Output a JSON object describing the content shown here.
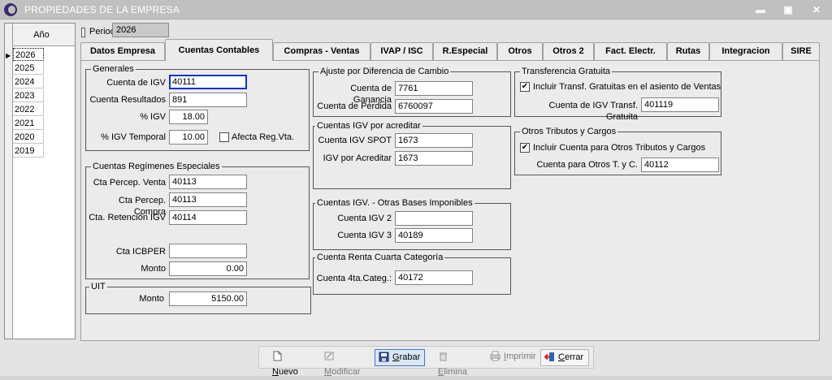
{
  "window": {
    "title": "PROPIEDADES DE LA EMPRESA",
    "minimize_glyph": "▬",
    "maximize_glyph": "▣",
    "close_glyph": "✕"
  },
  "years": {
    "header": "Año",
    "marker": "▶",
    "items": [
      "2026",
      "2025",
      "2024",
      "2023",
      "2022",
      "2021",
      "2020",
      "2019"
    ]
  },
  "periodo": {
    "label": "Periodo",
    "value": "2026"
  },
  "tabs": [
    "Datos Empresa",
    "Cuentas Contables",
    "Compras - Ventas",
    "IVAP / ISC",
    "R.Especial",
    "Otros",
    "Otros 2",
    "Fact. Electr.",
    "Rutas",
    "Integracion",
    "SIRE"
  ],
  "generales": {
    "title": "Generales",
    "cuenta_igv": {
      "label": "Cuenta de IGV",
      "value": "40111"
    },
    "cuenta_resultados": {
      "label": "Cuenta Resultados",
      "value": "891"
    },
    "pct_igv": {
      "label": "% IGV",
      "value": "18.00"
    },
    "pct_igv_temporal": {
      "label": "% IGV Temporal",
      "value": "10.00"
    },
    "afecta_reg_vta": {
      "label": "Afecta Reg.Vta.",
      "checked": false
    }
  },
  "regimenes": {
    "title": "Cuentas Regímenes Especiales",
    "percep_venta": {
      "label": "Cta Percep. Venta",
      "value": "40113"
    },
    "percep_compra": {
      "label": "Cta Percep. Compra",
      "value": "40113"
    },
    "retencion_igv": {
      "label": "Cta. Retención IGV",
      "value": "40114"
    },
    "icbper": {
      "label": "Cta ICBPER",
      "value": ""
    },
    "monto": {
      "label": "Monto",
      "value": "0.00"
    }
  },
  "uit": {
    "title": "UIT",
    "monto": {
      "label": "Monto",
      "value": "5150.00"
    }
  },
  "ajuste": {
    "title": "Ajuste por Diferencia de Cambio",
    "ganancia": {
      "label": "Cuenta de Ganancia",
      "value": "7761"
    },
    "perdida": {
      "label": "Cuenta de Pérdida",
      "value": "6760097"
    }
  },
  "igv_acreditar": {
    "title": "Cuentas IGV por acreditar",
    "spot": {
      "label": "Cuenta IGV SPOT",
      "value": "1673"
    },
    "acreditar": {
      "label": "IGV por Acreditar",
      "value": "1673"
    }
  },
  "otras_bases": {
    "title": "Cuentas IGV. - Otras Bases Imponibles",
    "igv2": {
      "label": "Cuenta IGV 2",
      "value": ""
    },
    "igv3": {
      "label": "Cuenta IGV 3",
      "value": "40189"
    }
  },
  "renta_cuarta": {
    "title": "Cuenta Renta Cuarta Categoría",
    "cuenta": {
      "label": "Cuenta 4ta.Categ.:",
      "value": "40172"
    }
  },
  "transferencia": {
    "title": "Transferencia Gratuita",
    "incluir": {
      "label": "Incluir Transf. Gratuitas en el asiento de Ventas",
      "checked": true
    },
    "cuenta": {
      "label": "Cuenta de IGV Transf. Gratuita",
      "value": "401119"
    }
  },
  "otros_tributos": {
    "title": "Otros Tributos y Cargos",
    "incluir": {
      "label": "Incluir Cuenta para Otros Tributos y Cargos",
      "checked": true
    },
    "cuenta": {
      "label": "Cuenta para Otros T. y C.",
      "value": "40112"
    }
  },
  "check_glyph": "✔",
  "toolbar": {
    "nuevo": {
      "mnemonic": "N",
      "rest": "uevo",
      "enabled": true
    },
    "modificar": {
      "mnemonic": "M",
      "rest": "odificar",
      "enabled": false
    },
    "grabar": {
      "mnemonic": "G",
      "rest": "rabar",
      "enabled": true
    },
    "elimina": {
      "mnemonic": "E",
      "rest": "limina",
      "enabled": false
    },
    "imprimir": {
      "mnemonic": "I",
      "rest": "mprimir",
      "enabled": false
    },
    "cerrar": {
      "mnemonic": "C",
      "rest": "errar",
      "enabled": true
    }
  },
  "colors": {
    "focus_border": "#1030d8",
    "titlebar": "#c0c0c0",
    "selected_button": "#dbe6f6"
  }
}
